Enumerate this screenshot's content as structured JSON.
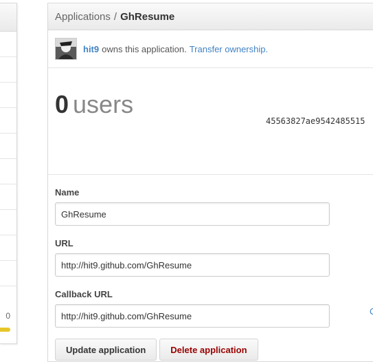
{
  "sidebar": {
    "bottom_text": "0"
  },
  "breadcrumb": {
    "root": "Applications",
    "separator": "/",
    "current": "GhResume"
  },
  "owner": {
    "username": "hit9",
    "text": "owns this application.",
    "transfer_link": "Transfer ownership."
  },
  "stats": {
    "user_count": "0",
    "user_label": "users",
    "client_id": "45563827ae9542485515"
  },
  "form": {
    "name_label": "Name",
    "name_value": "GhResume",
    "url_label": "URL",
    "url_value": "http://hit9.github.com/GhResume",
    "callback_label": "Callback URL",
    "callback_value": "http://hit9.github.com/GhResume",
    "side_char": "C"
  },
  "actions": {
    "update_label": "Update application",
    "delete_label": "Delete application"
  },
  "colors": {
    "link": "#4183c4",
    "danger": "#990000"
  }
}
